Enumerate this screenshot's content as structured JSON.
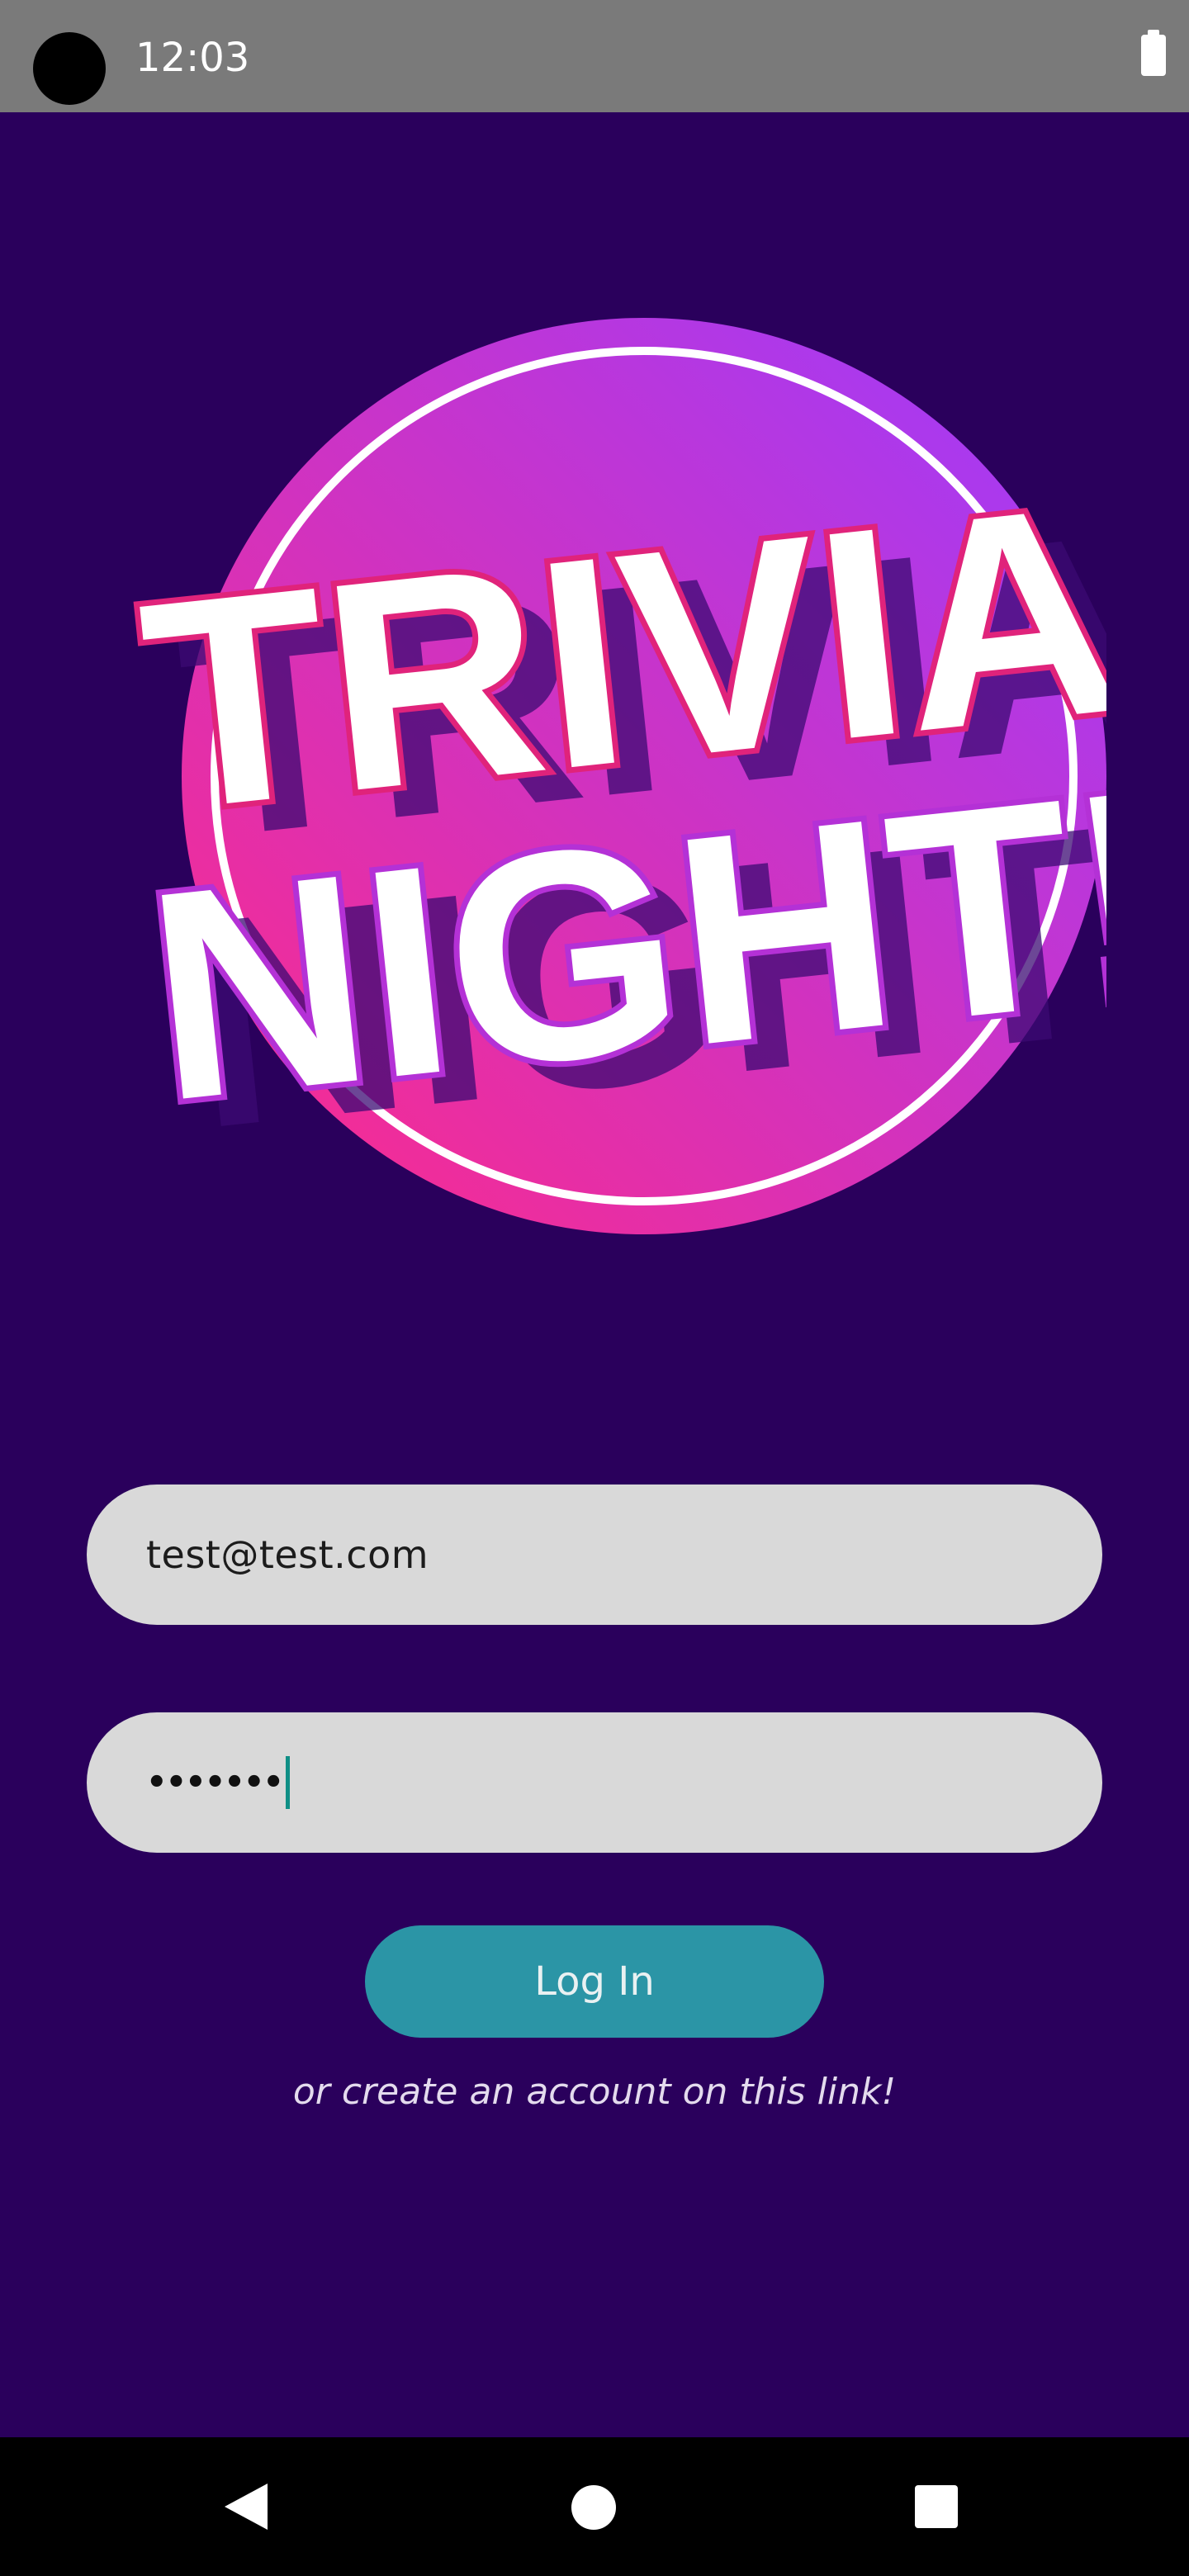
{
  "status_bar": {
    "time": "12:03",
    "icons": [
      "camera-dot",
      "battery-icon"
    ]
  },
  "logo": {
    "line1": "TRIVIA",
    "line2": "NIGHT!",
    "colors": {
      "circle_left": "#ff2a88",
      "circle_right": "#9c3cff",
      "text_fill": "#ffffff",
      "shadow": "#3c0a73"
    }
  },
  "form": {
    "email_value": "test@test.com",
    "password_mask": "•••••••",
    "login_label": "Log In",
    "create_account_text": "or create an account on this link!"
  },
  "colors": {
    "background": "#2a005c",
    "field_bg": "#d9d9d9",
    "button_bg": "#2b95a6",
    "caret": "#0f8f86"
  },
  "nav_bar": {
    "icons": [
      "back-icon",
      "home-icon",
      "recents-icon"
    ]
  }
}
